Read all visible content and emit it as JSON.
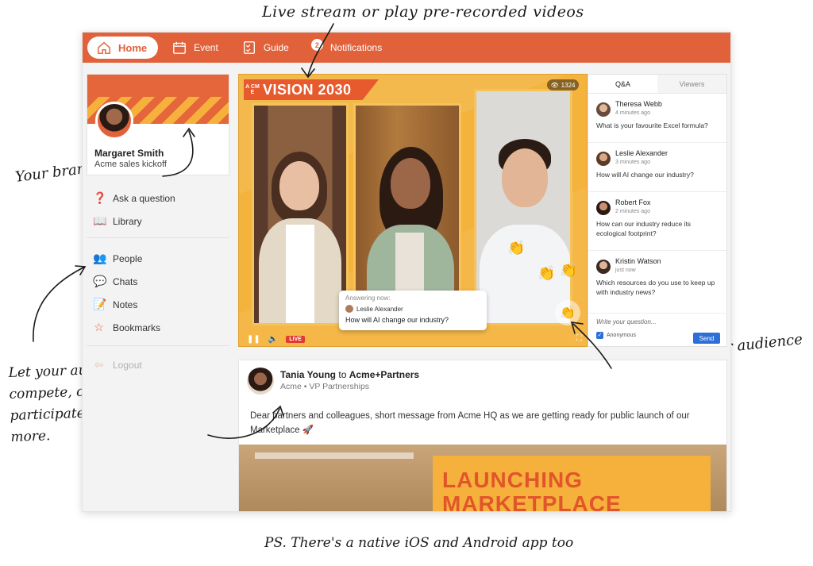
{
  "annotations": {
    "top": "Live stream or play pre-recorded videos",
    "brand": "Your brand here",
    "audience": "Let your audience network, compete, chat, share updates, participate in quizzes and much more.",
    "connect": "Really connect with your audience",
    "ps": "PS. There's a native iOS and Android app too"
  },
  "nav": {
    "home": "Home",
    "event": "Event",
    "guide": "Guide",
    "notifications": "Notifications",
    "notifications_count": "2"
  },
  "profile": {
    "name": "Margaret Smith",
    "subtitle": "Acme sales kickoff"
  },
  "sidebar": {
    "items_a": [
      "Ask a question",
      "Library"
    ],
    "items_b": [
      "People",
      "Chats",
      "Notes",
      "Bookmarks"
    ],
    "logout": "Logout"
  },
  "video": {
    "brand_small": "A CM E",
    "title": "VISION 2030",
    "viewer_count": "1324",
    "answering_label": "Answering now:",
    "answering_user": "Leslie Alexander",
    "answering_question": "How will AI change our industry?",
    "live_label": "LIVE"
  },
  "qa": {
    "tabs": [
      "Q&A",
      "Viewers"
    ],
    "questions": [
      {
        "name": "Theresa Webb",
        "time": "4 minutes ago",
        "text": "What is your favourite Excel formula?"
      },
      {
        "name": "Leslie Alexander",
        "time": "3 minutes ago",
        "text": "How will AI change our industry?"
      },
      {
        "name": "Robert Fox",
        "time": "2 minutes ago",
        "text": "How can our industry reduce its ecological footprint?"
      },
      {
        "name": "Kristin Watson",
        "time": "just now",
        "text": "Which resources do you use to keep up with industry news?"
      }
    ],
    "input_placeholder": "Write your question...",
    "anonymous_label": "Anonymous",
    "send_label": "Send"
  },
  "post": {
    "author": "Tania Young",
    "to": "to",
    "target": "Acme+Partners",
    "subtitle": "Acme • VP Partnerships",
    "body": "Dear partners and colleagues, short message from Acme HQ as we are getting ready for public launch of our Marketplace 🚀",
    "image_text_line1": "LAUNCHING",
    "image_text_line2": "MARKETPLACE"
  },
  "colors": {
    "brand_orange": "#e0613a",
    "video_yellow": "#f3b33d",
    "send_blue": "#2c6fd6"
  }
}
